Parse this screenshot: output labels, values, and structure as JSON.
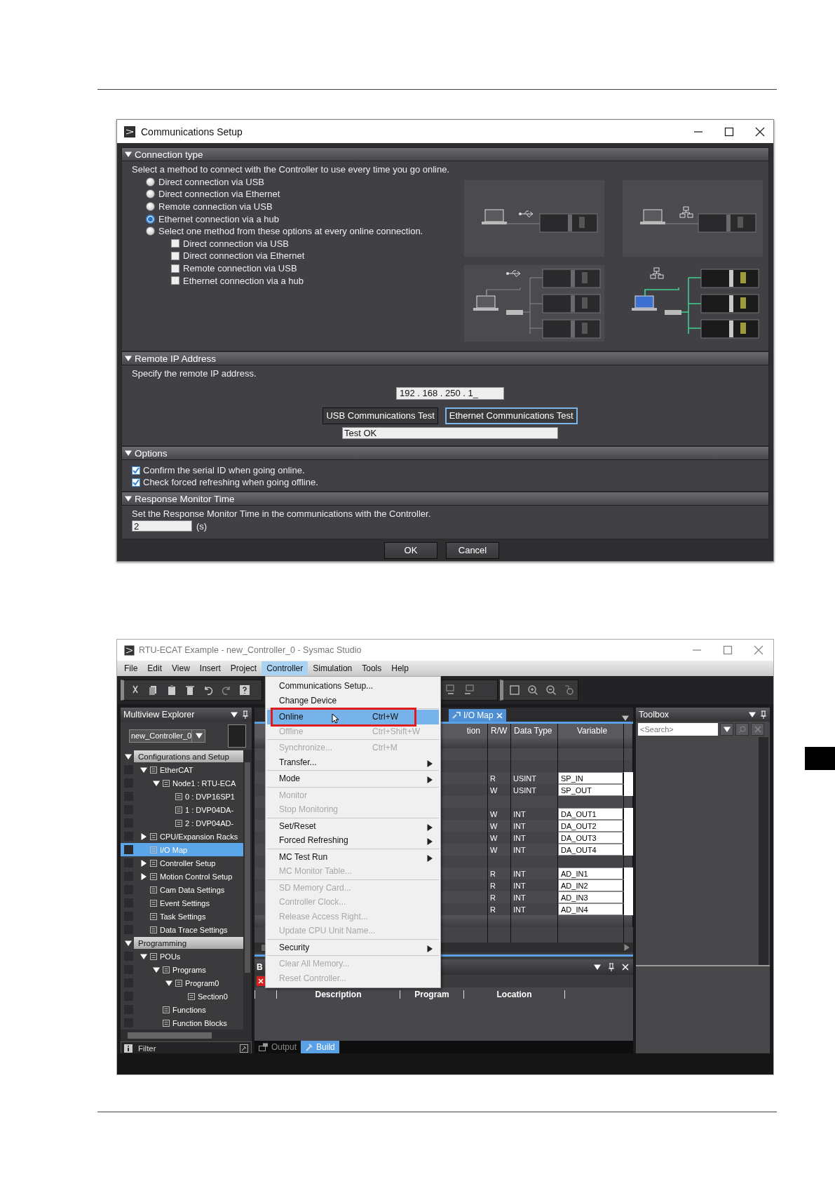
{
  "dialog": {
    "title": "Communications Setup",
    "connection_type": {
      "heading": "Connection type",
      "instruction": "Select a method to connect with the Controller to use every time you go online.",
      "options": [
        {
          "label": "Direct connection via USB",
          "selected": false
        },
        {
          "label": "Direct connection via Ethernet",
          "selected": false
        },
        {
          "label": "Remote connection via USB",
          "selected": false
        },
        {
          "label": "Ethernet connection via a hub",
          "selected": true
        },
        {
          "label": "Select one method from these options at every online connection.",
          "selected": false
        }
      ],
      "sub_options": [
        {
          "label": "Direct connection via USB",
          "checked": false
        },
        {
          "label": "Direct connection via Ethernet",
          "checked": false
        },
        {
          "label": "Remote connection via USB",
          "checked": false
        },
        {
          "label": "Ethernet connection via a hub",
          "checked": false
        }
      ]
    },
    "remote_ip": {
      "heading": "Remote IP Address",
      "instruction": "Specify the remote IP address.",
      "ip_address": "192 . 168 . 250 . 1_",
      "buttons": [
        {
          "label": "USB Communications Test",
          "focused": false
        },
        {
          "label": "Ethernet Communications Test",
          "focused": true
        }
      ],
      "result": "Test OK"
    },
    "options": {
      "heading": "Options",
      "items": [
        {
          "label": "Confirm the serial ID when going online.",
          "checked": true
        },
        {
          "label": "Check forced refreshing when going offline.",
          "checked": true
        }
      ]
    },
    "response_monitor": {
      "heading": "Response Monitor Time",
      "instruction": "Set the Response Monitor Time in the communications with the Controller.",
      "value": "2",
      "unit": "(s)"
    },
    "buttons": [
      "OK",
      "Cancel"
    ]
  },
  "app": {
    "title": "RTU-ECAT Example - new_Controller_0 - Sysmac Studio",
    "menu_bar": [
      {
        "label": "File",
        "selected": false
      },
      {
        "label": "Edit",
        "selected": false
      },
      {
        "label": "View",
        "selected": false
      },
      {
        "label": "Insert",
        "selected": false
      },
      {
        "label": "Project",
        "selected": false
      },
      {
        "label": "Controller",
        "selected": true
      },
      {
        "label": "Simulation",
        "selected": false
      },
      {
        "label": "Tools",
        "selected": false
      },
      {
        "label": "Help",
        "selected": false
      }
    ],
    "explorer": {
      "title": "Multiview Explorer",
      "controller": "new_Controller_0",
      "filter": "Filter",
      "tree": [
        {
          "label": "Configurations and Setup",
          "selected": false,
          "expanded": true,
          "children": [
            {
              "label": "EtherCAT",
              "selected": false,
              "expanded": true,
              "children": [
                {
                  "label": "Node1 : RTU-ECA",
                  "selected": false,
                  "expanded": true,
                  "children": [
                    {
                      "label": "0 : DVP16SP1",
                      "selected": false
                    },
                    {
                      "label": "1 : DVP04DA-",
                      "selected": false
                    },
                    {
                      "label": "2 : DVP04AD-",
                      "selected": false
                    }
                  ]
                }
              ]
            },
            {
              "label": "CPU/Expansion Racks",
              "selected": false,
              "expanded": false
            },
            {
              "label": "I/O Map",
              "selected": true
            },
            {
              "label": "Controller Setup",
              "selected": false,
              "expanded": false
            },
            {
              "label": "Motion Control Setup",
              "selected": false,
              "expanded": false
            },
            {
              "label": "Cam Data Settings",
              "selected": false
            },
            {
              "label": "Event Settings",
              "selected": false
            },
            {
              "label": "Task Settings",
              "selected": false
            },
            {
              "label": "Data Trace Settings",
              "selected": false
            }
          ]
        },
        {
          "label": "Programming",
          "selected": false,
          "expanded": true,
          "children": [
            {
              "label": "POUs",
              "selected": false,
              "expanded": true,
              "children": [
                {
                  "label": "Programs",
                  "selected": false,
                  "expanded": true,
                  "children": [
                    {
                      "label": "Program0",
                      "selected": false,
                      "expanded": true,
                      "children": [
                        {
                          "label": "Section0",
                          "selected": false
                        }
                      ]
                    }
                  ]
                },
                {
                  "label": "Functions",
                  "selected": false
                },
                {
                  "label": "Function Blocks",
                  "selected": false
                }
              ]
            }
          ]
        }
      ]
    },
    "editor": {
      "tab": "I/O Map",
      "columns": [
        "tion",
        "R/W",
        "Data Type",
        "Variable"
      ],
      "rows": [
        {
          "kind": "blank"
        },
        {
          "kind": "blank"
        },
        {
          "kind": "io",
          "rw": "R",
          "data_type": "USINT",
          "variable": "SP_IN"
        },
        {
          "kind": "io",
          "rw": "W",
          "data_type": "USINT",
          "variable": "SP_OUT"
        },
        {
          "kind": "blank"
        },
        {
          "kind": "io",
          "rw": "W",
          "data_type": "INT",
          "variable": "DA_OUT1"
        },
        {
          "kind": "io",
          "rw": "W",
          "data_type": "INT",
          "variable": "DA_OUT2"
        },
        {
          "kind": "io",
          "rw": "W",
          "data_type": "INT",
          "variable": "DA_OUT3"
        },
        {
          "kind": "io",
          "rw": "W",
          "data_type": "INT",
          "variable": "DA_OUT4"
        },
        {
          "kind": "blank"
        },
        {
          "kind": "io",
          "rw": "R",
          "data_type": "INT",
          "variable": "AD_IN1"
        },
        {
          "kind": "io",
          "rw": "R",
          "data_type": "INT",
          "variable": "AD_IN2"
        },
        {
          "kind": "io",
          "rw": "R",
          "data_type": "INT",
          "variable": "AD_IN3"
        },
        {
          "kind": "io",
          "rw": "R",
          "data_type": "INT",
          "variable": "AD_IN4"
        }
      ]
    },
    "toolbox": {
      "title": "Toolbox",
      "search": {
        "placeholder": "<Search>"
      }
    },
    "build_pane": {
      "title": "B",
      "columns": [
        "Description",
        "Program",
        "Location"
      ]
    },
    "bottom_tabs": [
      {
        "label": "Output",
        "selected": false
      },
      {
        "label": "Build",
        "selected": true
      }
    ],
    "menu": {
      "groups": [
        {
          "items": [
            {
              "label": "Communications Setup...",
              "disabled": false,
              "selected": false,
              "submenu": false
            },
            {
              "label": "Change Device",
              "disabled": false,
              "selected": false,
              "submenu": false
            }
          ]
        },
        {
          "items": [
            {
              "label": "Online",
              "shortcut": "Ctrl+W",
              "disabled": false,
              "selected": true,
              "submenu": false
            },
            {
              "label": "Offline",
              "shortcut": "Ctrl+Shift+W",
              "disabled": true,
              "selected": false,
              "submenu": false
            }
          ]
        },
        {
          "items": [
            {
              "label": "Synchronize...",
              "shortcut": "Ctrl+M",
              "disabled": true,
              "selected": false,
              "submenu": false
            },
            {
              "label": "Transfer...",
              "disabled": false,
              "selected": false,
              "submenu": true
            }
          ]
        },
        {
          "items": [
            {
              "label": "Mode",
              "disabled": false,
              "selected": false,
              "submenu": true
            }
          ]
        },
        {
          "items": [
            {
              "label": "Monitor",
              "disabled": true,
              "selected": false,
              "submenu": false
            },
            {
              "label": "Stop Monitoring",
              "disabled": true,
              "selected": false,
              "submenu": false
            }
          ]
        },
        {
          "items": [
            {
              "label": "Set/Reset",
              "disabled": false,
              "selected": false,
              "submenu": true
            },
            {
              "label": "Forced Refreshing",
              "disabled": false,
              "selected": false,
              "submenu": true
            }
          ]
        },
        {
          "items": [
            {
              "label": "MC Test Run",
              "disabled": false,
              "selected": false,
              "submenu": true
            },
            {
              "label": "MC Monitor Table...",
              "disabled": true,
              "selected": false,
              "submenu": false
            }
          ]
        },
        {
          "items": [
            {
              "label": "SD Memory Card...",
              "disabled": true,
              "selected": false,
              "submenu": false
            },
            {
              "label": "Controller Clock...",
              "disabled": true,
              "selected": false,
              "submenu": false
            },
            {
              "label": "Release Access Right...",
              "disabled": true,
              "selected": false,
              "submenu": false
            },
            {
              "label": "Update CPU Unit Name...",
              "disabled": true,
              "selected": false,
              "submenu": false
            }
          ]
        },
        {
          "items": [
            {
              "label": "Security",
              "disabled": false,
              "selected": false,
              "submenu": true
            }
          ]
        },
        {
          "items": [
            {
              "label": "Clear All Memory...",
              "disabled": true,
              "selected": false,
              "submenu": false
            },
            {
              "label": "Reset Controller...",
              "disabled": true,
              "selected": false,
              "submenu": false
            }
          ]
        }
      ]
    }
  }
}
